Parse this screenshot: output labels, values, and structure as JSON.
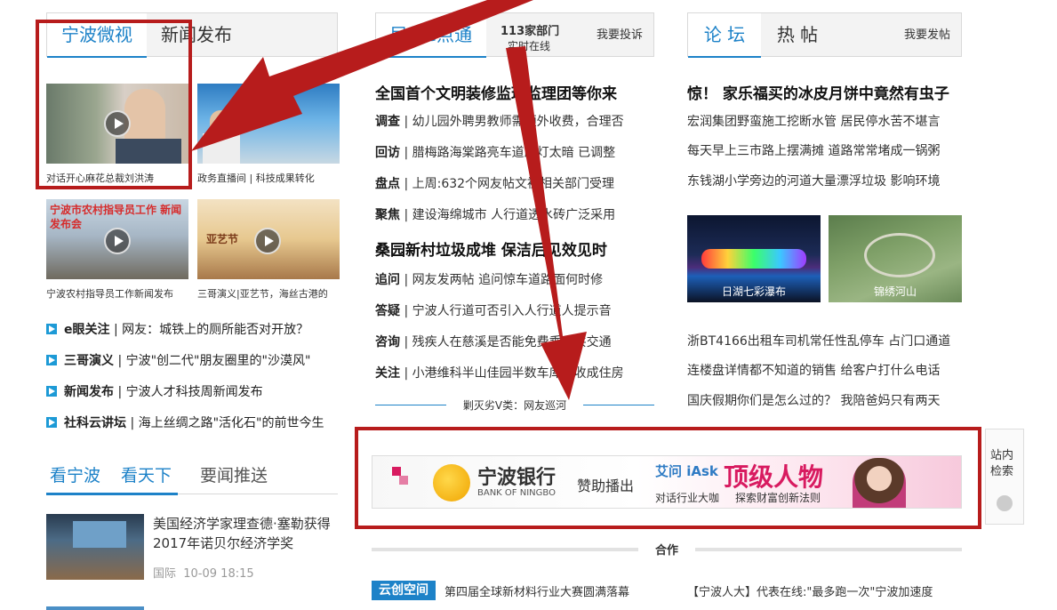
{
  "col1": {
    "tabs": [
      "宁波微视",
      "新闻发布"
    ],
    "thumbs": [
      {
        "caption": "对话开心麻花总裁刘洪涛"
      },
      {
        "caption": "政务直播间 | 科技成果转化"
      },
      {
        "caption": "宁波农村指导员工作新闻发布",
        "overlay": "宁波市农村指导员工作 新闻发布会"
      },
      {
        "caption": "三哥演义|亚艺节，海丝古港的",
        "overlay": "亚艺节"
      }
    ],
    "list": [
      {
        "tag": "e眼关注",
        "text": "| 网友：城铁上的厕所能否对开放？"
      },
      {
        "tag": "三哥演义",
        "text": "| 宁波\"创二代\"朋友圈里的\"沙漠风\""
      },
      {
        "tag": "新闻发布",
        "text": "| 宁波人才科技周新闻发布"
      },
      {
        "tag": "社科云讲坛",
        "text": "| 海上丝绸之路\"活化石\"的前世今生"
      }
    ],
    "tabs2": [
      "看宁波",
      "看天下",
      "要闻推送"
    ],
    "story": {
      "title": "美国经济学家理查德·塞勒获得2017年诺贝尔经济学奖",
      "meta": "国际  10-09 18:15"
    }
  },
  "col2": {
    "tab": "民生e点通",
    "count": "113家部门",
    "count_sub": "实时在线",
    "complain": "我要投诉",
    "headline1": "全国首个文明装修监理监理团等你来",
    "items1": [
      {
        "tag": "调查",
        "text": "| 幼儿园外聘男教师需额外收费，合理否"
      },
      {
        "tag": "回访",
        "text": "| 腊梅路海棠路亮车道路灯太暗 已调整"
      },
      {
        "tag": "盘点",
        "text": "| 上周:632个网友帖文被相关部门受理"
      },
      {
        "tag": "聚焦",
        "text": "| 建设海绵城市 人行道透水砖广泛采用"
      }
    ],
    "headline2": "桑园新村垃圾成堆 保洁后见效见时",
    "items2": [
      {
        "tag": "追问",
        "text": "| 网友发两帖 追问惊车道路面何时修"
      },
      {
        "tag": "答疑",
        "text": "| 宁波人行道可否引入人行道人提示音"
      },
      {
        "tag": "咨询",
        "text": "| 残疾人在慈溪是否能免费乘公共交通"
      },
      {
        "tag": "关注",
        "text": "| 小港维科半山佳园半数车库租收成住房"
      }
    ],
    "divider": "剿灭劣V类：网友巡河"
  },
  "col3": {
    "tabs": [
      "论 坛",
      "热 帖"
    ],
    "post": "我要发帖",
    "headline": "惊！ 家乐福买的冰皮月饼中竟然有虫子",
    "lines1": [
      "宏润集团野蛮施工挖断水管 居民停水苦不堪言",
      "每天早上三市路上摆满摊 道路常常堵成一锅粥",
      "东钱湖小学旁边的河道大量漂浮垃圾 影响环境"
    ],
    "photos": [
      {
        "caption": "日湖七彩瀑布"
      },
      {
        "caption": "锦绣河山"
      }
    ],
    "lines2": [
      "浙BT4166出租车司机常任性乱停车 占门口通道",
      "连楼盘详情都不知道的销售 给客户打什么电话",
      "国庆假期你们是怎么过的？ 我陪爸妈只有两天"
    ]
  },
  "banner": {
    "bank": "宁波银行",
    "bank_en": "BANK OF NINGBO",
    "sponsor": "赞助播出",
    "ask_logo": "艾问 iAsk",
    "big": "顶级人物",
    "sub1": "对话行业大咖",
    "sub2": "探索财富创新法则"
  },
  "side_search": {
    "line1": "站内",
    "line2": "检索"
  },
  "coop": {
    "label": "合作"
  },
  "bottom": {
    "logo": "云创空间",
    "left": "第四届全球新材料行业大赛圆满落幕",
    "right": "【宁波人大】代表在线:\"最多跑一次\"宁波加速度"
  },
  "colors": {
    "accent": "#1d82c8",
    "annotation": "#b71c1c"
  }
}
